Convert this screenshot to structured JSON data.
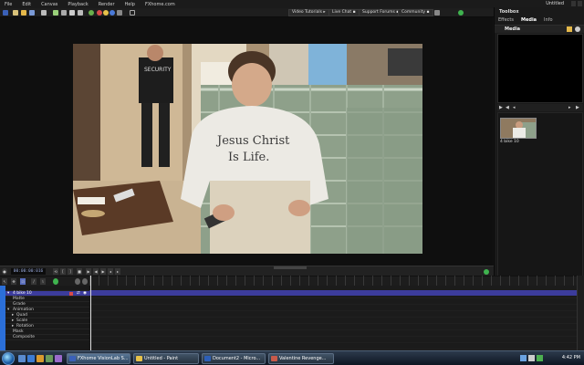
{
  "app": {
    "title": "Untitled"
  },
  "menu": {
    "items": [
      "File",
      "Edit",
      "Canvas",
      "Playback",
      "Render",
      "Help",
      "FXhome.com"
    ]
  },
  "toolbar": {
    "links": [
      {
        "label": "Video Tutorials",
        "icon": "play-icon"
      },
      {
        "label": "Live Chat",
        "icon": "chat-icon"
      },
      {
        "label": "Support Forums",
        "icon": "forum-icon"
      },
      {
        "label": "Community",
        "icon": "community-icon"
      }
    ]
  },
  "toolbox": {
    "title": "Toolbox",
    "tabs": [
      "Effects",
      "Media",
      "Info"
    ],
    "active_tab": "Media",
    "media_header": "Media",
    "media_items": [
      {
        "label": "4 bike 10"
      }
    ]
  },
  "timeline": {
    "timecode": "00:00:00:016",
    "tracks": [
      {
        "label": "4 bike 10",
        "level": 0,
        "main": true
      },
      {
        "label": "Matte",
        "level": 1
      },
      {
        "label": "Grade",
        "level": 1
      },
      {
        "label": "Animation",
        "level": 1
      },
      {
        "label": "Quad",
        "level": 2
      },
      {
        "label": "Scale",
        "level": 2
      },
      {
        "label": "Rotation",
        "level": 2
      },
      {
        "label": "Mask",
        "level": 1
      },
      {
        "label": "Composite",
        "level": 1
      }
    ]
  },
  "video": {
    "shirt_text_line1": "Jesus Christ",
    "shirt_text_line2": "Is Life.",
    "back_text": "SECURITY"
  },
  "taskbar": {
    "tasks": [
      {
        "label": "FXhome VisionLab S...",
        "active": true
      },
      {
        "label": "Untitled - Paint",
        "active": false
      },
      {
        "label": "Document2 - Micro...",
        "active": false
      },
      {
        "label": "Valentine Revenge...",
        "active": false
      }
    ],
    "clock": "4:42 PM"
  },
  "colors": {
    "accent": "#3c3c9c",
    "taskbar": "#1a2533"
  }
}
